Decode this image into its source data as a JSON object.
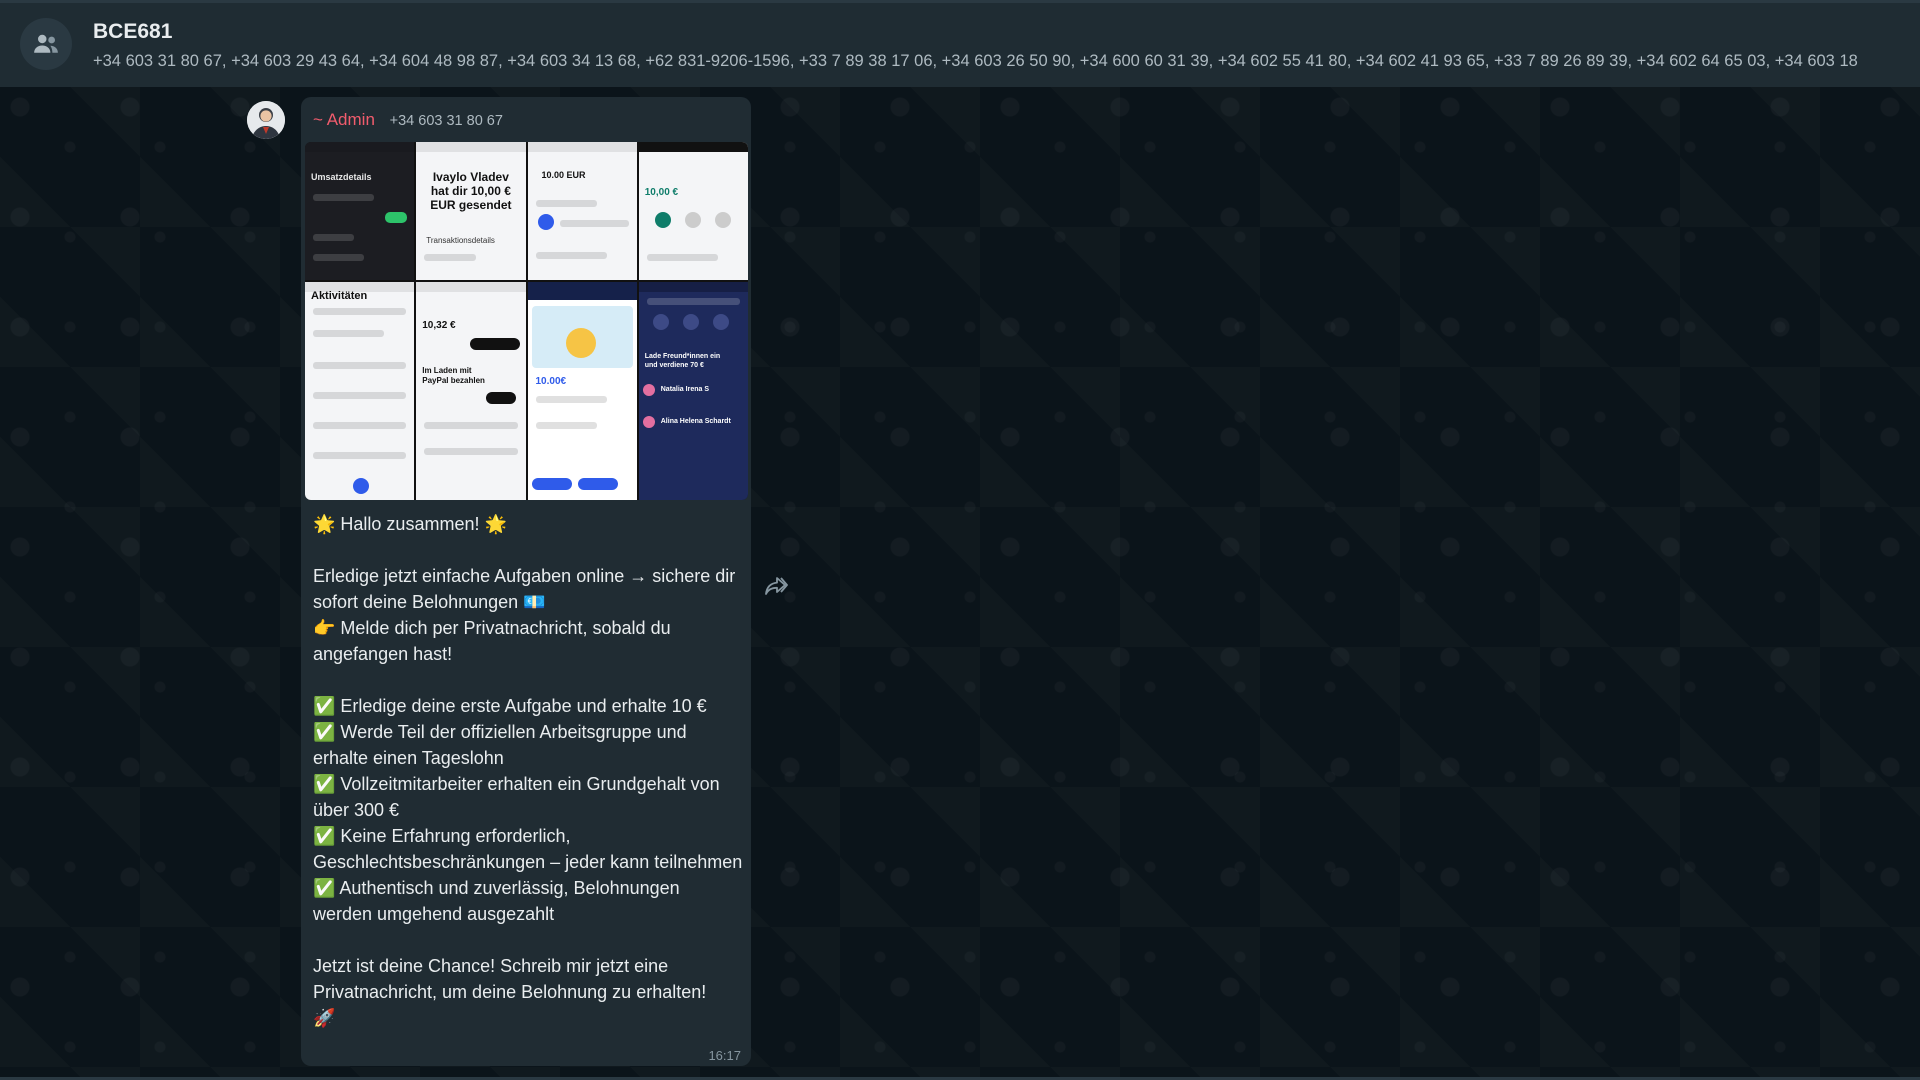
{
  "header": {
    "group_name": "BCE681",
    "members": "+34 603 31 80 67, +34 603 29 43 64, +34 604 48 98 87, +34 603 34 13 68, +62 831-9206-1596, +33 7 89 38 17 06, +34 603 26 50 90, +34 600 60 31 39, +34 602 55 41 80, +34 602 41 93 65, +33 7 89 26 89 39, +34 602 64 65 03, +34 603 18"
  },
  "message": {
    "sender_name": "~ Admin",
    "sender_phone": "+34 603 31 80 67",
    "time": "16:17",
    "text": "🌟 Hallo zusammen! 🌟\n\nErledige jetzt einfache Aufgaben online → sichere dir sofort deine Belohnungen 💶\n👉 Melde dich per Privatnachricht, sobald du angefangen hast!\n\n✅ Erledige deine erste Aufgabe und erhalte 10 €\n✅ Werde Teil der offiziellen Arbeitsgruppe und erhalte einen Tageslohn\n✅ Vollzeitmitarbeiter erhalten ein Grundgehalt von über 300 €\n✅ Keine Erfahrung erforderlich, Geschlechtsbeschränkungen – jeder kann teilnehmen\n✅ Authentisch und zuverlässig, Belohnungen werden umgehend ausgezahlt\n\nJetzt ist deine Chance! Schreib mir jetzt eine Privatnachricht, um deine Belohnung zu erhalten!\n🚀"
  },
  "thumbnails": {
    "t1": "Umsatzdetails",
    "t2_title": "Ivaylo Vladev hat dir 10,00 € EUR gesendet",
    "t2_sub": "Transaktionsdetails",
    "t3": "10.00 EUR",
    "t4": "10,00 €",
    "t5": "Aktivitäten",
    "t6_amount": "10,32 €",
    "t6_promo": "Im Laden mit PayPal bezahlen",
    "t7": "10.00€",
    "t8_invite": "Lade Freund*innen ein und verdiene 70 €",
    "t8_name1": "Natalia Irena S",
    "t8_name2": "Alina Helena Schardt"
  },
  "colors": {
    "accent_sender": "#f15c6d",
    "bubble": "#202c33",
    "background": "#0b141a"
  }
}
